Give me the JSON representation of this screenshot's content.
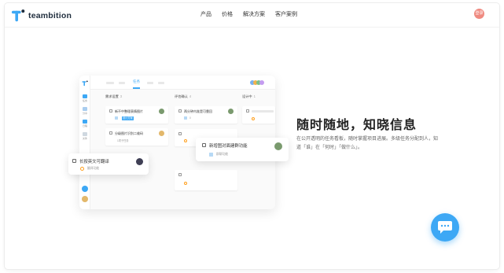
{
  "brand": {
    "name": "teambition",
    "accent": "#3da8f5"
  },
  "nav": {
    "items": [
      "产品",
      "价格",
      "解决方案",
      "客户案例"
    ],
    "avatar_label": "登录"
  },
  "board": {
    "tabs": [
      "任务"
    ],
    "sidebar_items": [
      "任务",
      "分享",
      "日程",
      "文件"
    ],
    "columns": [
      {
        "title": "需求设置",
        "count": "3"
      },
      {
        "title": "评估确认",
        "count": "4"
      },
      {
        "title": "设计中",
        "count": "1"
      }
    ],
    "cards": {
      "c1": "新不中整理表情图片",
      "c1_tag": "设计方案",
      "c2": "分级图片识别二维码",
      "c2_sub": "1项子任务",
      "c3": "两分钟内准是可靠回",
      "c3_sub": "0"
    }
  },
  "floats": {
    "left": {
      "title": "长按英文可翻译",
      "sub": "翻译功能"
    },
    "right": {
      "title": "新增图对面建群功能",
      "sub": "群聊功能"
    }
  },
  "hero": {
    "headline": "随时随地，知晓信息",
    "description": "在公开透明的任务看板，随时掌握项目进展。多级任务分配到人，知道「谁」在「何时」「做什么」。"
  },
  "chat": {
    "icon": "chat-bubble-icon"
  }
}
